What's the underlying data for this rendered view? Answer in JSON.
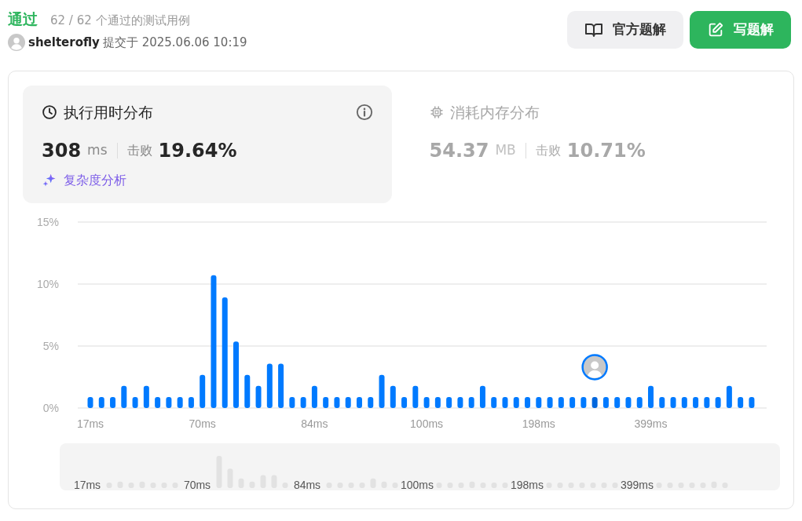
{
  "header": {
    "status": "通过",
    "cases": "62 / 62 个通过的测试用例",
    "user": "shelterofly",
    "submitted": "提交于 2025.06.06 10:19"
  },
  "buttons": [
    {
      "label": "官方题解",
      "kind": "secondary"
    },
    {
      "label": "写题解",
      "kind": "primary"
    }
  ],
  "stats": [
    {
      "kind": "runtime",
      "title": "执行用时分布",
      "selected": true,
      "value": "308",
      "unit": "ms",
      "beats_label": "击败",
      "beats": "19.64%",
      "link": "复杂度分析"
    },
    {
      "kind": "memory",
      "title": "消耗内存分布",
      "selected": false,
      "value": "54.37",
      "unit": "MB",
      "beats_label": "击败",
      "beats": "10.71%"
    }
  ],
  "chart": {
    "chart_data": {
      "type": "bar",
      "ylim": [
        0,
        15
      ],
      "yticks": [
        {
          "value": 0,
          "label": "0%"
        },
        {
          "value": 5,
          "label": "5%"
        },
        {
          "value": 10,
          "label": "10%"
        },
        {
          "value": 15,
          "label": "15%"
        }
      ],
      "categories": [
        "17ms",
        null,
        null,
        null,
        null,
        null,
        null,
        null,
        null,
        null,
        "70ms",
        null,
        null,
        null,
        null,
        null,
        null,
        null,
        null,
        null,
        "84ms",
        null,
        null,
        null,
        null,
        null,
        null,
        null,
        null,
        null,
        "100ms",
        null,
        null,
        null,
        null,
        null,
        null,
        null,
        null,
        null,
        "198ms",
        null,
        null,
        null,
        null,
        null,
        null,
        null,
        null,
        null,
        "399ms",
        null,
        null,
        null,
        null,
        null,
        null,
        null,
        null,
        null
      ],
      "stacked": true,
      "series": [
        {
          "color": "#007aff",
          "values": [
            0.89,
            0.89,
            0.89,
            1.79,
            0.89,
            1.79,
            0.89,
            0.89,
            0.89,
            0.89,
            2.68,
            10.71,
            8.93,
            5.36,
            2.68,
            1.79,
            3.57,
            3.57,
            0.89,
            0.89,
            1.79,
            0.89,
            0.89,
            0.89,
            0.89,
            0.89,
            2.68,
            1.79,
            0.89,
            1.79,
            0.89,
            0.89,
            0.89,
            0.89,
            0.89,
            1.79,
            0.89,
            0.89,
            0.89,
            0.89,
            0.89,
            0.89,
            0.89,
            0.89,
            0.89,
            null,
            0.89,
            0.89,
            0.89,
            0.89,
            1.79,
            0.89,
            0.89,
            0.89,
            0.89,
            0.89,
            0.89,
            1.79,
            0.89,
            0.89
          ]
        },
        {
          "color": "#0066dd",
          "values": [
            null,
            null,
            null,
            null,
            null,
            null,
            null,
            null,
            null,
            null,
            null,
            null,
            null,
            null,
            null,
            null,
            null,
            null,
            null,
            null,
            null,
            null,
            null,
            null,
            null,
            null,
            null,
            null,
            null,
            null,
            null,
            null,
            null,
            null,
            null,
            null,
            null,
            null,
            null,
            null,
            null,
            null,
            null,
            null,
            null,
            0.89,
            null,
            null,
            null,
            null,
            null,
            null,
            null,
            null,
            null,
            null,
            null,
            null,
            null,
            null
          ]
        }
      ]
    }
  },
  "navigator": {
    "labels": [
      "17ms",
      "70ms",
      "84ms",
      "100ms",
      "198ms",
      "399ms"
    ]
  }
}
